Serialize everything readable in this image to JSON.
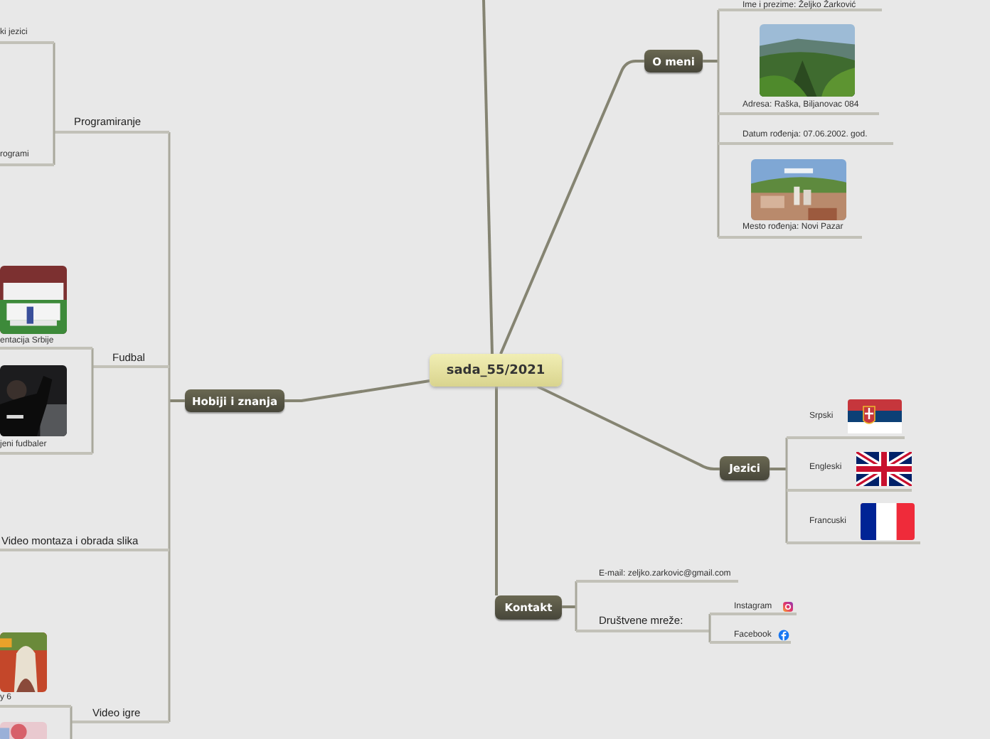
{
  "center": {
    "title": "sada_55/2021"
  },
  "branches": [
    {
      "label": "O meni",
      "topics": [
        {
          "text": "Ime i prezime: Željko Žarković"
        },
        {
          "text": "Adresa: Raška, Biljanovac 084",
          "image": {
            "kind": "picture"
          }
        },
        {
          "text": "Datum rođenja: 07.06.2002. god."
        },
        {
          "text": "Mesto rođenja: Novi Pazar",
          "image": {
            "kind": "picture"
          }
        }
      ]
    },
    {
      "label": "Jezici",
      "topics": [
        {
          "text": "Srpski"
        },
        {
          "text": "Engleski"
        },
        {
          "text": "Francuski"
        }
      ]
    },
    {
      "label": "Kontakt",
      "topics": [
        {
          "text": "E-mail: zeljko.zarkovic@gmail.com"
        },
        {
          "text": "Društvene mreže:",
          "children": [
            {
              "text": "Instagram"
            },
            {
              "text": "Facebook"
            }
          ]
        }
      ]
    },
    {
      "label": "Hobiji i znanja",
      "topics": [
        {
          "text": "Programiranje",
          "children": [
            {
              "text": "ki jezici"
            },
            {
              "text": "rogrami"
            }
          ]
        },
        {
          "text": "Fudbal",
          "children": [
            {
              "text": "entacija Srbije",
              "image": {
                "kind": "picture"
              }
            },
            {
              "text": "jeni fudbaler",
              "image": {
                "kind": "picture"
              }
            }
          ]
        },
        {
          "text": "Video montaza i obrada slika"
        },
        {
          "text": "Video igre",
          "children": [
            {
              "text": "y 6",
              "image": {
                "kind": "picture"
              }
            },
            {
              "image": {
                "kind": "picture"
              }
            }
          ]
        }
      ]
    }
  ]
}
